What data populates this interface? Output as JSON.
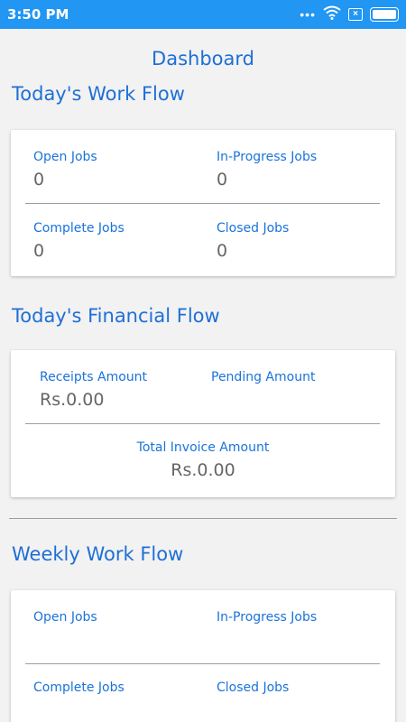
{
  "status_bar": {
    "time": "3:50 PM",
    "icons": [
      "more-dots-icon",
      "wifi-icon",
      "no-sim-icon",
      "battery-icon"
    ],
    "battery_level": 1.0,
    "background": "#2196f3"
  },
  "page_title": "Dashboard",
  "todays_work_flow": {
    "title": "Today's Work Flow",
    "open_jobs": {
      "label": "Open Jobs",
      "value": "0"
    },
    "in_progress_jobs": {
      "label": "In-Progress Jobs",
      "value": "0"
    },
    "complete_jobs": {
      "label": "Complete Jobs",
      "value": "0"
    },
    "closed_jobs": {
      "label": "Closed Jobs",
      "value": "0"
    }
  },
  "todays_financial_flow": {
    "title": "Today's Financial Flow",
    "receipts": {
      "label": "Receipts Amount",
      "value": "Rs.0.00"
    },
    "pending": {
      "label": "Pending Amount",
      "value": ""
    },
    "total_invoice": {
      "label": "Total Invoice Amount",
      "value": "Rs.0.00"
    }
  },
  "weekly_work_flow": {
    "title": "Weekly Work Flow",
    "open_jobs": {
      "label": "Open Jobs"
    },
    "in_progress_jobs": {
      "label": "In-Progress Jobs"
    },
    "complete_jobs": {
      "label": "Complete Jobs"
    },
    "closed_jobs": {
      "label": "Closed Jobs"
    }
  },
  "colors": {
    "accent": "#1e6fd6",
    "label": "#1a73d9",
    "value": "#666666",
    "background": "#f2f2f2"
  }
}
